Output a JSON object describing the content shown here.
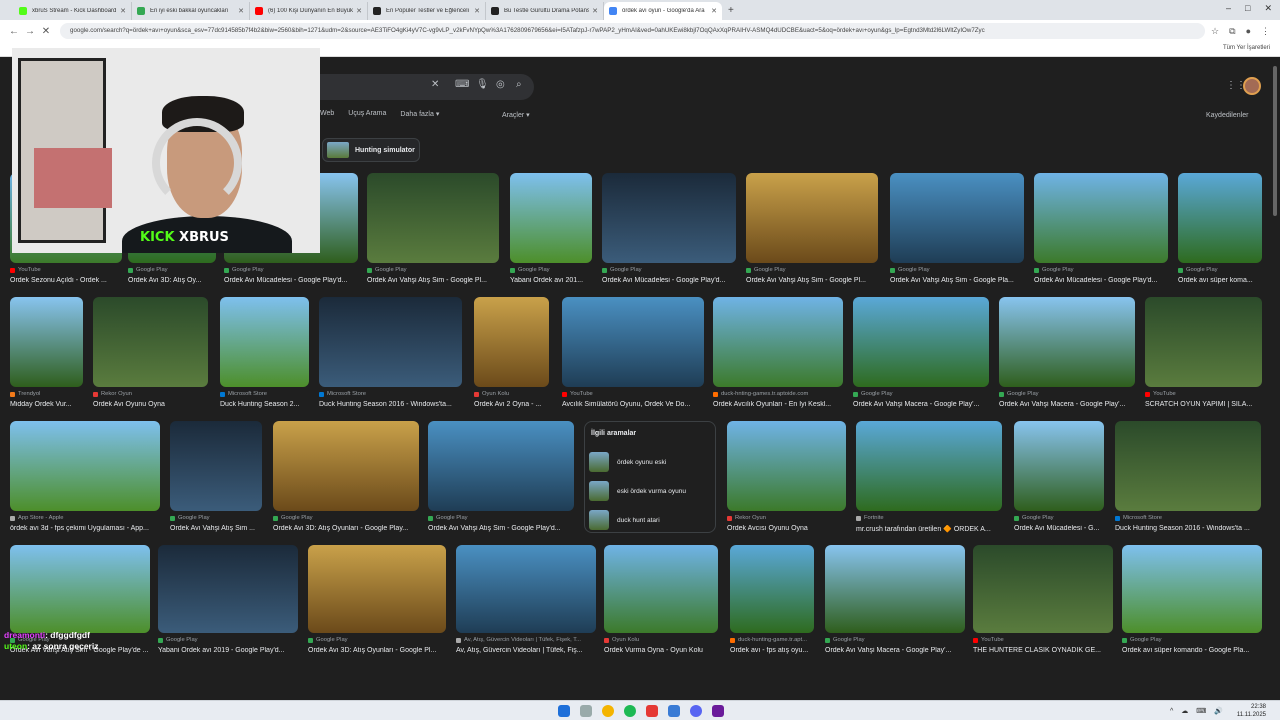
{
  "browser": {
    "tabs": [
      {
        "title": "xbruS Stream - Kick Dashboard",
        "color": "#53fc18"
      },
      {
        "title": "En iyi eski bakkal oyuncakları",
        "color": "#34a853"
      },
      {
        "title": "(6) 100 Kişi Dünyanın En Büyük",
        "color": "#ff0000"
      },
      {
        "title": "En Popüler Testler ve Eğlenceli",
        "color": "#222222"
      },
      {
        "title": "Bu Testle Gürültü Drama Potans",
        "color": "#222222"
      },
      {
        "title": "ördek avı oyun - Google'da Ara",
        "color": "#4285f4",
        "active": true
      }
    ],
    "new_tab": "+",
    "window_controls": [
      "–",
      "□",
      "✕"
    ],
    "url": "google.com/search?q=ördek+avı+oyun&sca_esv=77dc914585b7f4b2&biw=2560&bih=1271&udm=2&source=AE3TiFO4gKi4yV7C-vg9vLP_v2kFvNYpQw%3A1762809679656&ei=I5ATafzpJ-r7wPAP2_yHmAI&ved=0ahUKEwi8kbjl7OqQAxXqPRAIHV-ASMQ4dUDCBE&uact=5&oq=ördek+avı+oyun&gs_lp=Egtnd3Mtd2l6LWltZyIOw7Zyc",
    "bookmarks_right": "Tüm Yer İşaretleri"
  },
  "google": {
    "tabs": [
      "Web",
      "Uçuş Arama",
      "Daha fazla ▾"
    ],
    "tools": "Araçler ▾",
    "saved": "Kaydedilenler",
    "chip": "Hunting simulator",
    "related": {
      "title": "İlgili aramalar",
      "items": [
        "ördek oyunu eski",
        "eski ördek vurma oyunu",
        "duck hunt atari"
      ]
    },
    "results": [
      {
        "source": "YouTube",
        "title": "Ördek Sezonu Açıldı - Ördek ...",
        "scolor": "#ff0000"
      },
      {
        "source": "Google Play",
        "title": "Ördek Avı 3D: Atış Oy...",
        "scolor": "#34a853"
      },
      {
        "source": "Google Play",
        "title": "Ördek Avı Mücadelesi - Google Play'd...",
        "scolor": "#34a853"
      },
      {
        "source": "Google Play",
        "title": "Ördek Avı Vahşi Atış Sim - Google Pl...",
        "scolor": "#34a853"
      },
      {
        "source": "Google Play",
        "title": "Yabani Ördek avı 201...",
        "scolor": "#34a853"
      },
      {
        "source": "Google Play",
        "title": "Ördek Avı Mücadelesi - Google Play'd...",
        "scolor": "#34a853"
      },
      {
        "source": "Google Play",
        "title": "Ördek Avı Vahşi Atış Sim - Google Pl...",
        "scolor": "#34a853"
      },
      {
        "source": "Google Play",
        "title": "Ördek Avı Vahşi Atış Sim - Google Pla...",
        "scolor": "#34a853"
      },
      {
        "source": "Google Play",
        "title": "Ördek Avı Mücadelesi - Google Play'd...",
        "scolor": "#34a853"
      },
      {
        "source": "Google Play",
        "title": "Ördek avı süper koma...",
        "scolor": "#34a853"
      },
      {
        "source": "Trendyol",
        "title": "Midday Ördek Vur...",
        "scolor": "#f27a1a"
      },
      {
        "source": "Rekor Oyun",
        "title": "Ördek Avı Oyunu Oyna",
        "scolor": "#e53935"
      },
      {
        "source": "Microsoft Store",
        "title": "Duck Hunting Season 2...",
        "scolor": "#0078d4"
      },
      {
        "source": "Microsoft Store",
        "title": "Duck Hunting Season 2016 - Windows'ta...",
        "scolor": "#0078d4"
      },
      {
        "source": "Oyun Kolu",
        "title": "Ördek Avı 2 Oyna - ...",
        "scolor": "#e53935"
      },
      {
        "source": "YouTube",
        "title": "Avcılık Simülatörü Oyunu, Ördek Ve Do...",
        "scolor": "#ff0000"
      },
      {
        "source": "duck-hnting-games.tr.aptoide.com",
        "title": "Ördek Avcılık Oyunları - En İyi Keskl...",
        "scolor": "#ff6d00"
      },
      {
        "source": "Google Play",
        "title": "Ördek Avı Vahşi Macera - Google Play'...",
        "scolor": "#34a853"
      },
      {
        "source": "Google Play",
        "title": "Ördek Avı Vahşi Macera - Google Play'...",
        "scolor": "#34a853"
      },
      {
        "source": "YouTube",
        "title": "SCRATCH OYUN YAPIMI | SİLA...",
        "scolor": "#ff0000"
      },
      {
        "source": "App Store - Apple",
        "title": "ördek avı 3d - fps çekimi Uygulaması - App...",
        "scolor": "#aaaaaa"
      },
      {
        "source": "Google Play",
        "title": "Ördek Avı Vahşi Atış Sim ...",
        "scolor": "#34a853"
      },
      {
        "source": "Google Play",
        "title": "Ördek Avı 3D: Atış Oyunları - Google Play...",
        "scolor": "#34a853"
      },
      {
        "source": "Google Play",
        "title": "Ördek Avı Vahşi Atış Sim - Google Play'd...",
        "scolor": "#34a853"
      },
      {
        "source": "Rekor Oyun",
        "title": "Ördek Avcısı Oyunu Oyna",
        "scolor": "#e53935"
      },
      {
        "source": "Fortnite",
        "title": "mr.crush tarafından üretilen 🔶 ÖRDEK A...",
        "scolor": "#aaaaaa"
      },
      {
        "source": "Google Play",
        "title": "Ördek Avı Mücadelesi - G...",
        "scolor": "#34a853"
      },
      {
        "source": "Microsoft Store",
        "title": "Duck Hunting Season 2016 - Windows'ta ...",
        "scolor": "#0078d4"
      },
      {
        "source": "Google Play",
        "title": "Ördek Avı Vahşi Atış Sim - Google Play'de ...",
        "scolor": "#34a853"
      },
      {
        "source": "Google Play",
        "title": "Yabani Ördek avı 2019 - Google Play'd...",
        "scolor": "#34a853"
      },
      {
        "source": "Google Play",
        "title": "Ördek Avı 3D: Atış Oyunları - Google Pl...",
        "scolor": "#34a853"
      },
      {
        "source": "Av, Atış, Güvercin Videoları | Tüfek, Fişek, T...",
        "title": "Av, Atış, Güvercin Videoları | Tüfek, Fiş...",
        "scolor": "#aaaaaa"
      },
      {
        "source": "Oyun Kolu",
        "title": "Ördek Vurma Oyna - Oyun Kolu",
        "scolor": "#e53935"
      },
      {
        "source": "duck-hunting-game.tr.apt...",
        "title": "Ördek avı - fps atış oyu...",
        "scolor": "#ff6d00"
      },
      {
        "source": "Google Play",
        "title": "Ördek Avı Vahşi Macera - Google Play'...",
        "scolor": "#34a853"
      },
      {
        "source": "YouTube",
        "title": "THE HUNTERE CLASIK OYNADIK GE...",
        "scolor": "#ff0000"
      },
      {
        "source": "Google Play",
        "title": "Ördek avı süper komando - Google Pla...",
        "scolor": "#34a853"
      }
    ]
  },
  "overlay": {
    "webcam_label_a": "KICK",
    "webcam_label_b": " XBRUS",
    "chat": [
      {
        "user": "dreamonti",
        "msg": ": dfggdfgdf"
      },
      {
        "user": "uteon",
        "msg": ": az sonra geçeriz"
      }
    ]
  },
  "taskbar": {
    "time": "22:38",
    "date": "11.11.2025",
    "tray": "^ ☁ ⌨ 🔊"
  }
}
